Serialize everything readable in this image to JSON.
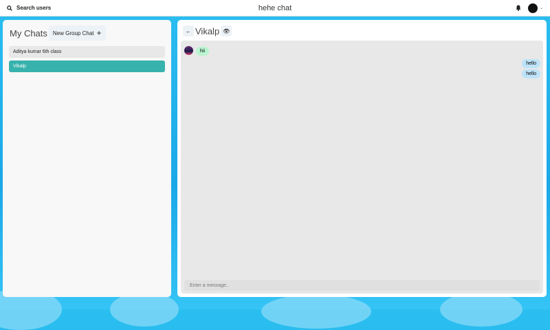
{
  "header": {
    "search_label": "Search users",
    "app_title": "hehe chat"
  },
  "sidebar": {
    "title": "My Chats",
    "new_group_label": "New Group Chat",
    "chats": [
      {
        "name": "Aditya kumar 6th class",
        "selected": false
      },
      {
        "name": "Vikalp",
        "selected": true
      }
    ]
  },
  "chat": {
    "name": "Vikalp",
    "messages": [
      {
        "text": "hii",
        "side": "left"
      },
      {
        "text": "hello",
        "side": "right"
      },
      {
        "text": "hello",
        "side": "right"
      }
    ],
    "input_placeholder": "Enter a message.."
  },
  "colors": {
    "selected": "#38b2ac",
    "incoming": "#b9f5d0",
    "outgoing": "#bee3f8"
  }
}
